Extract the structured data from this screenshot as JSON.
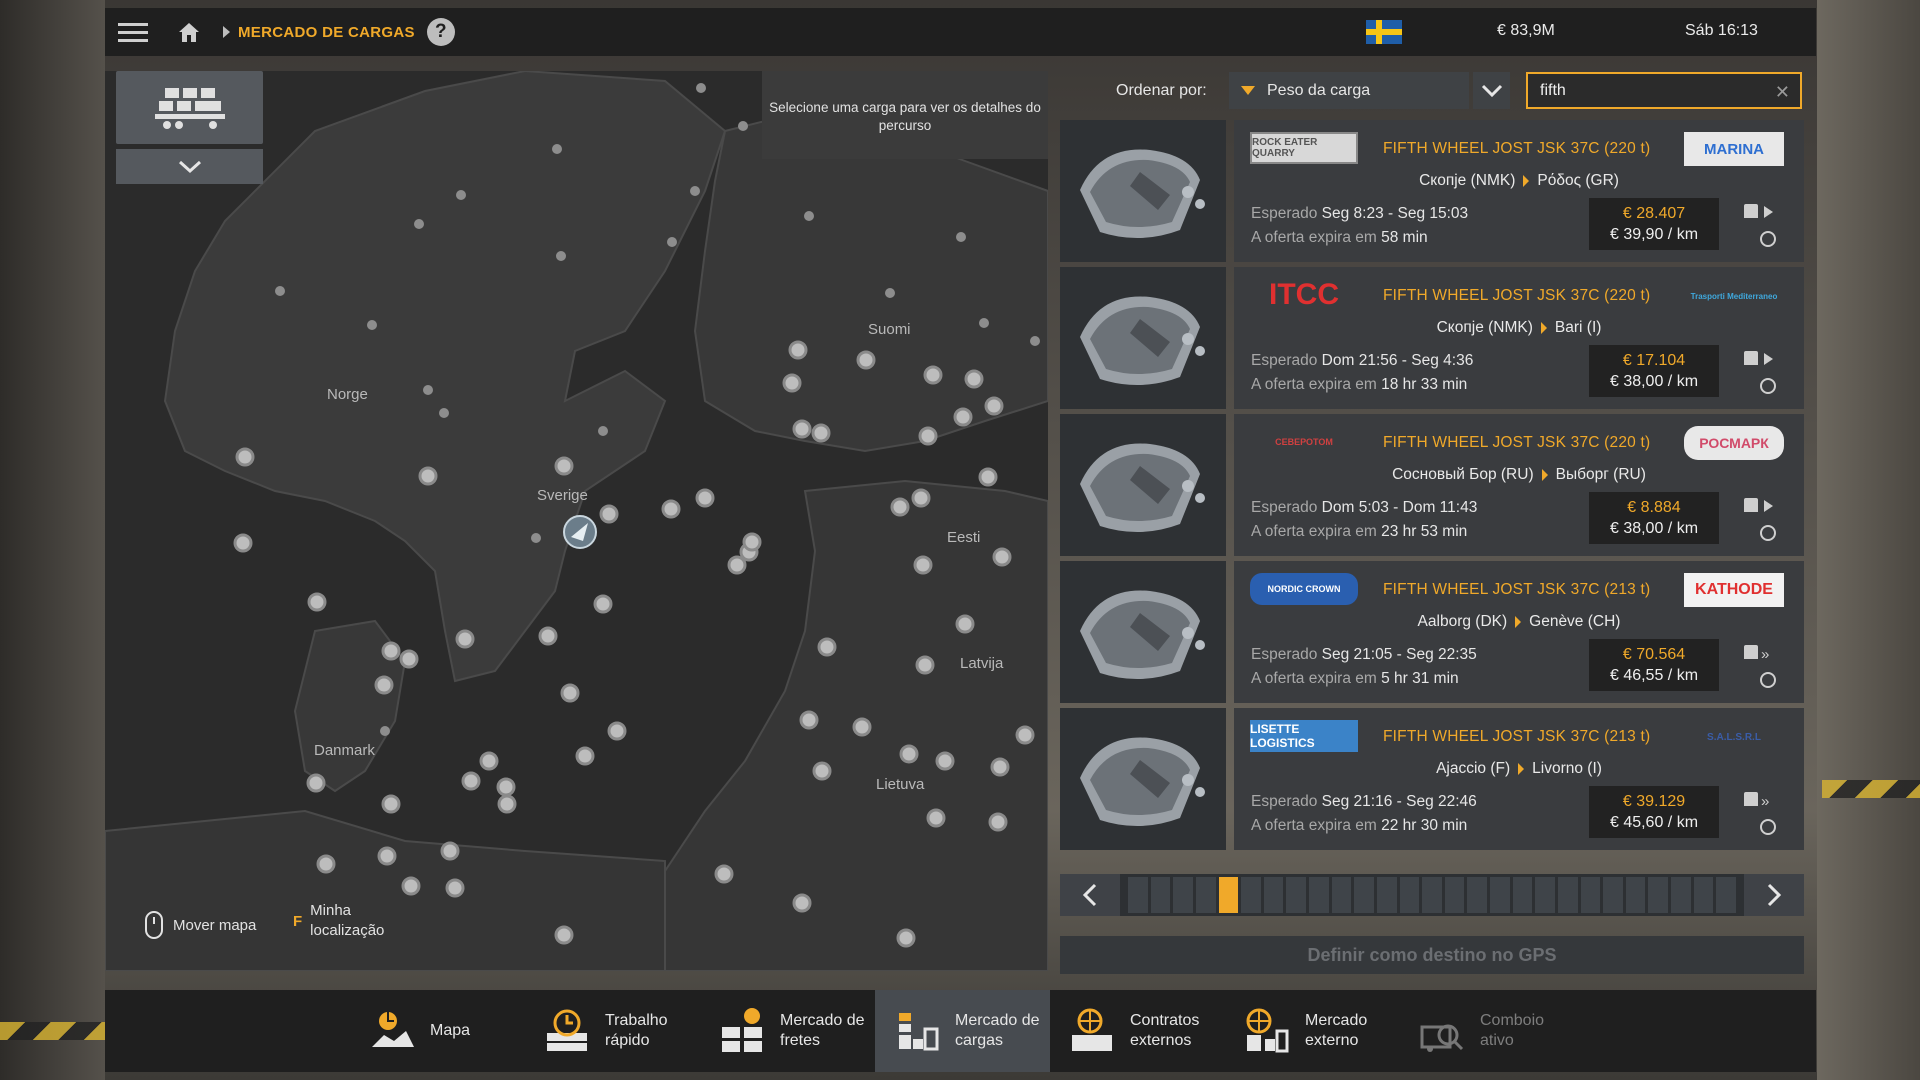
{
  "topbar": {
    "breadcrumb": "MERCADO DE CARGAS",
    "help": "?",
    "money": "€ 83,9M",
    "time": "Sáb 16:13"
  },
  "map": {
    "hint_text": "Selecione uma carga para ver os detalhes do percurso",
    "countries": [
      "Norge",
      "Suomi",
      "Sverige",
      "Eesti",
      "Latvija",
      "Danmark",
      "Lietuva"
    ],
    "controls": {
      "move_map": "Mover mapa",
      "my_location_key": "F",
      "my_location": "Minha localização"
    }
  },
  "sort": {
    "label": "Ordenar por:",
    "selected": "Peso da carga",
    "search_value": "fifth"
  },
  "cargos": [
    {
      "company": "ROCK EATER QUARRY",
      "cargo": "FIFTH WHEEL JOST JSK 37C (220 t)",
      "destination_company": "MARINA",
      "from": "Скопје (NMK)",
      "to": "Ρόδος (GR)",
      "expected_label": "Esperado",
      "expected": "Seg 8:23 - Seg 15:03",
      "expires_label": "A oferta expira em",
      "expires": "58 min",
      "price": "€ 28.407",
      "per_km": "€ 39,90 / km"
    },
    {
      "company": "ITCC",
      "cargo": "FIFTH WHEEL JOST JSK 37C (220 t)",
      "destination_company": "Trasporti Mediterraneo",
      "from": "Скопје (NMK)",
      "to": "Bari (I)",
      "expected_label": "Esperado",
      "expected": "Dom 21:56 - Seg 4:36",
      "expires_label": "A oferta expira em",
      "expires": "18 hr 33 min",
      "price": "€ 17.104",
      "per_km": "€ 38,00 / km"
    },
    {
      "company": "СЕВЕРОТОМ",
      "cargo": "FIFTH WHEEL JOST JSK 37C (220 t)",
      "destination_company": "РОСМАРК",
      "from": "Сосновый Бор (RU)",
      "to": "Выборг (RU)",
      "expected_label": "Esperado",
      "expected": "Dom 5:03 - Dom 11:43",
      "expires_label": "A oferta expira em",
      "expires": "23 hr 53 min",
      "price": "€ 8.884",
      "per_km": "€ 38,00 / km"
    },
    {
      "company": "NORDIC CROWN",
      "cargo": "FIFTH WHEEL JOST JSK 37C (213 t)",
      "destination_company": "KATHODE",
      "from": "Aalborg (DK)",
      "to": "Genève (CH)",
      "expected_label": "Esperado",
      "expected": "Seg 21:05 - Seg 22:35",
      "expires_label": "A oferta expira em",
      "expires": "5 hr 31 min",
      "price": "€ 70.564",
      "per_km": "€ 46,55 / km"
    },
    {
      "company": "LISETTE LOGISTICS",
      "cargo": "FIFTH WHEEL JOST JSK 37C (213 t)",
      "destination_company": "S.A.L.S.R.L",
      "from": "Ajaccio (F)",
      "to": "Livorno (I)",
      "expected_label": "Esperado",
      "expected": "Seg 21:16 - Seg 22:46",
      "expires_label": "A oferta expira em",
      "expires": "22 hr 30 min",
      "price": "€ 39.129",
      "per_km": "€ 45,60 / km"
    }
  ],
  "pager": {
    "page_count": 27,
    "active_page": 5
  },
  "gps_button": "Definir como destino no GPS",
  "tabs": [
    {
      "label": "Mapa"
    },
    {
      "label": "Trabalho rápido"
    },
    {
      "label": "Mercado de fretes"
    },
    {
      "label": "Mercado de cargas"
    },
    {
      "label": "Contratos externos"
    },
    {
      "label": "Mercado externo"
    },
    {
      "label": "Comboio ativo"
    }
  ],
  "colors": {
    "accent": "#f0a92a",
    "panel": "#3a3c3f",
    "bar": "#1f1f1f"
  }
}
